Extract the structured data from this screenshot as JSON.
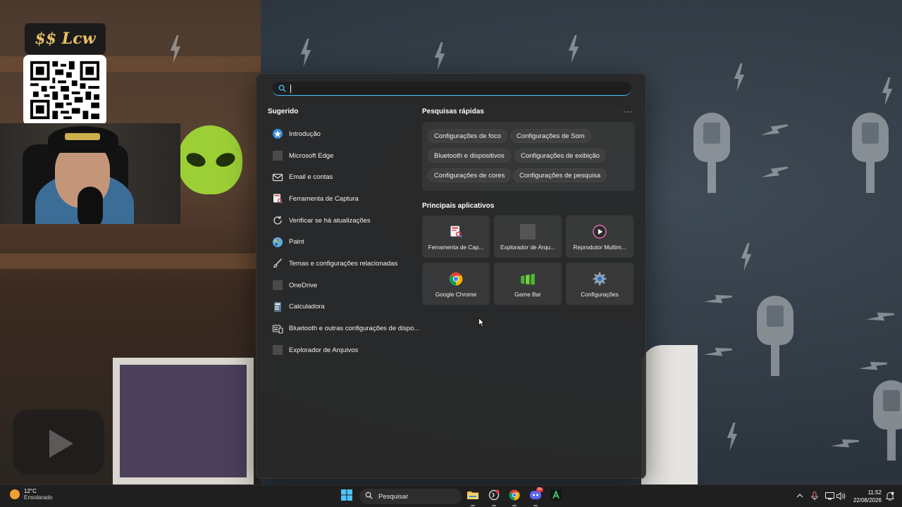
{
  "overlay": {
    "logo_text": "$$ Lcw"
  },
  "search": {
    "value": "",
    "placeholder": ""
  },
  "suggested": {
    "title": "Sugerido",
    "items": [
      {
        "label": "Introdução",
        "icon": "intro-icon"
      },
      {
        "label": "Microsoft Edge",
        "icon": "edge-icon"
      },
      {
        "label": "Email e contas",
        "icon": "mail-icon"
      },
      {
        "label": "Ferramenta de Captura",
        "icon": "snipping-tool-icon"
      },
      {
        "label": "Verificar se há atualizações",
        "icon": "refresh-icon"
      },
      {
        "label": "Paint",
        "icon": "paint-icon"
      },
      {
        "label": "Temas e configurações relacionadas",
        "icon": "brush-icon"
      },
      {
        "label": "OneDrive",
        "icon": "onedrive-icon"
      },
      {
        "label": "Calculadora",
        "icon": "calculator-icon"
      },
      {
        "label": "Bluetooth e outras configurações de dispo...",
        "icon": "bluetooth-settings-icon"
      },
      {
        "label": "Explorador de Arquivos",
        "icon": "file-explorer-icon"
      }
    ]
  },
  "quick_searches": {
    "title": "Pesquisas rápidas",
    "more_label": "···",
    "chips": [
      "Configurações de foco",
      "Configurações de Som",
      "Bluetooth e dispositivos",
      "Configurações de exibição",
      "Configurações de cores",
      "Configurações de pesquisa"
    ]
  },
  "top_apps": {
    "title": "Principais aplicativos",
    "apps": [
      {
        "label": "Ferramenta de Cap...",
        "icon": "snipping-tool-icon"
      },
      {
        "label": "Explorador de Arqu...",
        "icon": "file-explorer-icon"
      },
      {
        "label": "Reprodutor Multim...",
        "icon": "media-player-icon"
      },
      {
        "label": "Google Chrome",
        "icon": "chrome-icon"
      },
      {
        "label": "Game Bar",
        "icon": "game-bar-icon"
      },
      {
        "label": "Configurações",
        "icon": "settings-gear-icon"
      }
    ]
  },
  "taskbar": {
    "weather_temp": "12°C",
    "weather_desc": "Ensolarado",
    "search_label": "Pesquisar",
    "time": "11:52",
    "date": "22/08/2026",
    "badges": {
      "discord": "9+"
    }
  },
  "colors": {
    "accent": "#4cc2ff",
    "menu_bg": "#282828",
    "taskbar_bg": "#1f1f1f"
  }
}
